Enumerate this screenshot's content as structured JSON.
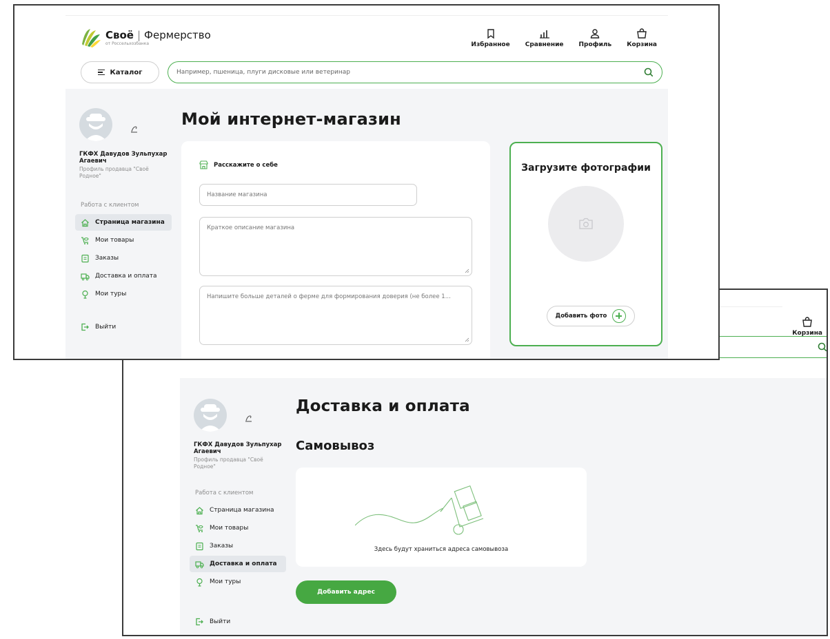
{
  "brand": {
    "name": "Своё",
    "section": "Фермерство",
    "subtitle": "от Россельхозбанка",
    "colors": {
      "accent": "#4caf50",
      "button": "#46a842"
    }
  },
  "header": {
    "nav": [
      {
        "label": "Избранное",
        "icon": "bookmark-icon"
      },
      {
        "label": "Сравнение",
        "icon": "compare-icon"
      },
      {
        "label": "Профиль",
        "icon": "user-icon"
      },
      {
        "label": "Корзина",
        "icon": "cart-icon"
      }
    ],
    "catalog_label": "Каталог",
    "search_placeholder": "Например, пшеница, плуги дисковые или ветеринар"
  },
  "profile": {
    "name": "ГКФХ Давудов Зульпухар Агаевич",
    "description": "Профиль продавца \"Своё Родное\""
  },
  "menu": {
    "title": "Работа с клиентом",
    "items": [
      {
        "label": "Страница магазина",
        "icon": "home-icon"
      },
      {
        "label": "Мои товары",
        "icon": "goods-icon"
      },
      {
        "label": "Заказы",
        "icon": "orders-icon"
      },
      {
        "label": "Доставка и оплата",
        "icon": "delivery-icon"
      },
      {
        "label": "Мои туры",
        "icon": "tours-icon"
      }
    ],
    "logout_label": "Выйти"
  },
  "shop_page": {
    "title": "Мой интернет-магазин",
    "form_heading": "Расскажите о себе",
    "fields": {
      "shop_name_placeholder": "Название магазина",
      "short_desc_placeholder": "Краткое описание магазина",
      "details_placeholder": "Напишите больше деталей о ферме для формирования доверия (не более 1..."
    },
    "photo_title": "Загрузите фотографии",
    "add_photo_label": "Добавить фото"
  },
  "delivery_page": {
    "title": "Доставка и оплата",
    "section_title": "Самовывоз",
    "empty_text": "Здесь будут храниться адреса самовывоза",
    "add_address_label": "Добавить адрес"
  }
}
